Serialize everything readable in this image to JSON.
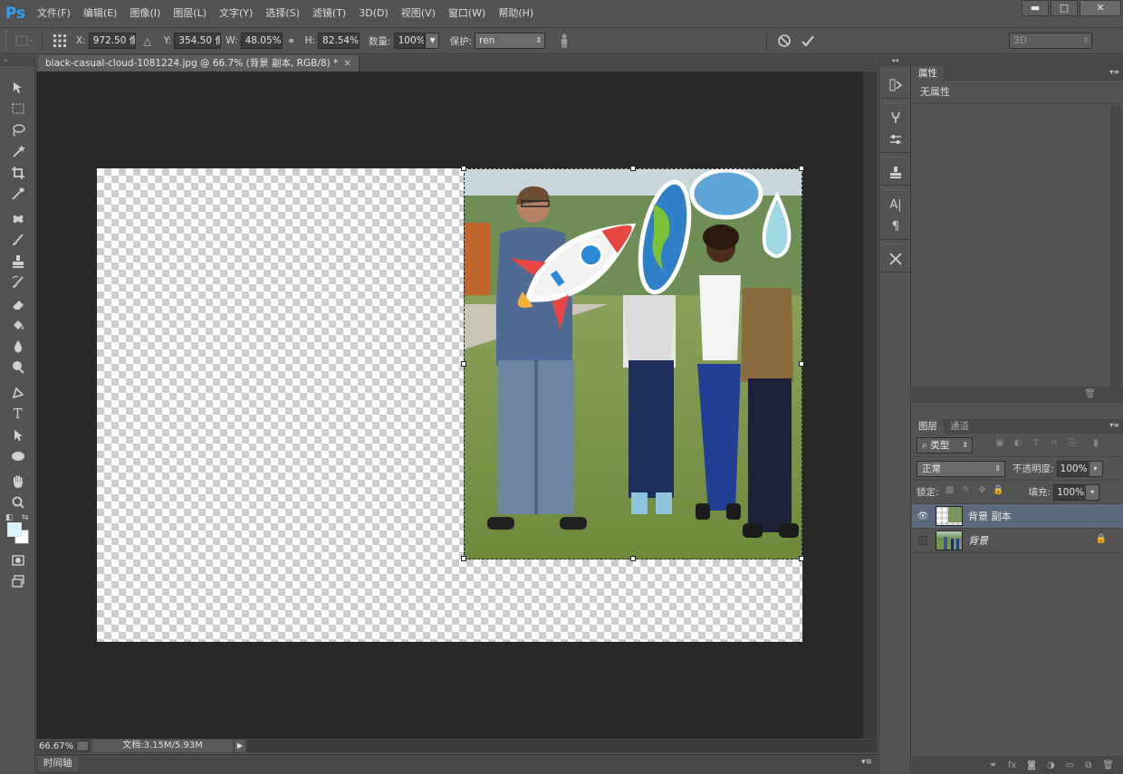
{
  "app": {
    "logo": "Ps"
  },
  "menu": [
    "文件(F)",
    "编辑(E)",
    "图像(I)",
    "图层(L)",
    "文字(Y)",
    "选择(S)",
    "滤镜(T)",
    "3D(D)",
    "视图(V)",
    "窗口(W)",
    "帮助(H)"
  ],
  "window_controls": {
    "minimize": "▬",
    "maximize": "□",
    "close": "✕"
  },
  "options": {
    "x_label": "X:",
    "x_value": "972.50 像",
    "y_label": "Y:",
    "y_value": "354.50 像",
    "w_label": "W:",
    "w_value": "48.05%",
    "h_label": "H:",
    "h_value": "82.54%",
    "amount_label": "数量:",
    "amount_value": "100%",
    "protect_label": "保护:",
    "protect_value": "ren",
    "workspace_value": "3D"
  },
  "document": {
    "tab_title": "black-casual-cloud-1081224.jpg @ 66.7% (背景 副本, RGB/8) *",
    "tab_close": "×",
    "zoom": "66.67%",
    "doc_info": "文档:3.15M/5.93M"
  },
  "timeline": {
    "label": "时间轴"
  },
  "tools": [
    "move-tool",
    "marquee-tool",
    "lasso-tool",
    "magic-wand-tool",
    "crop-tool",
    "eyedropper-tool",
    "healing-brush-tool",
    "brush-tool",
    "clone-stamp-tool",
    "history-brush-tool",
    "eraser-tool",
    "paint-bucket-tool",
    "blur-tool",
    "dodge-tool",
    "pen-tool",
    "type-tool",
    "path-selection-tool",
    "ellipse-tool",
    "hand-tool",
    "zoom-tool"
  ],
  "colors": {
    "foreground": "#d8f3fb",
    "background": "#ffffff",
    "accent_selected_layer": "#5b6a7c"
  },
  "properties": {
    "tab": "属性",
    "body_text": "无属性"
  },
  "layers_panel": {
    "tabs": [
      "图层",
      "通道"
    ],
    "filter_label": "类型",
    "blend_mode": "正常",
    "opacity_label": "不透明度:",
    "opacity_value": "100%",
    "lock_label": "锁定:",
    "fill_label": "填充:",
    "fill_value": "100%",
    "layers": [
      {
        "name": "背景 副本",
        "selected": true,
        "visible": true
      },
      {
        "name": "背景",
        "selected": false,
        "visible": false
      }
    ]
  }
}
